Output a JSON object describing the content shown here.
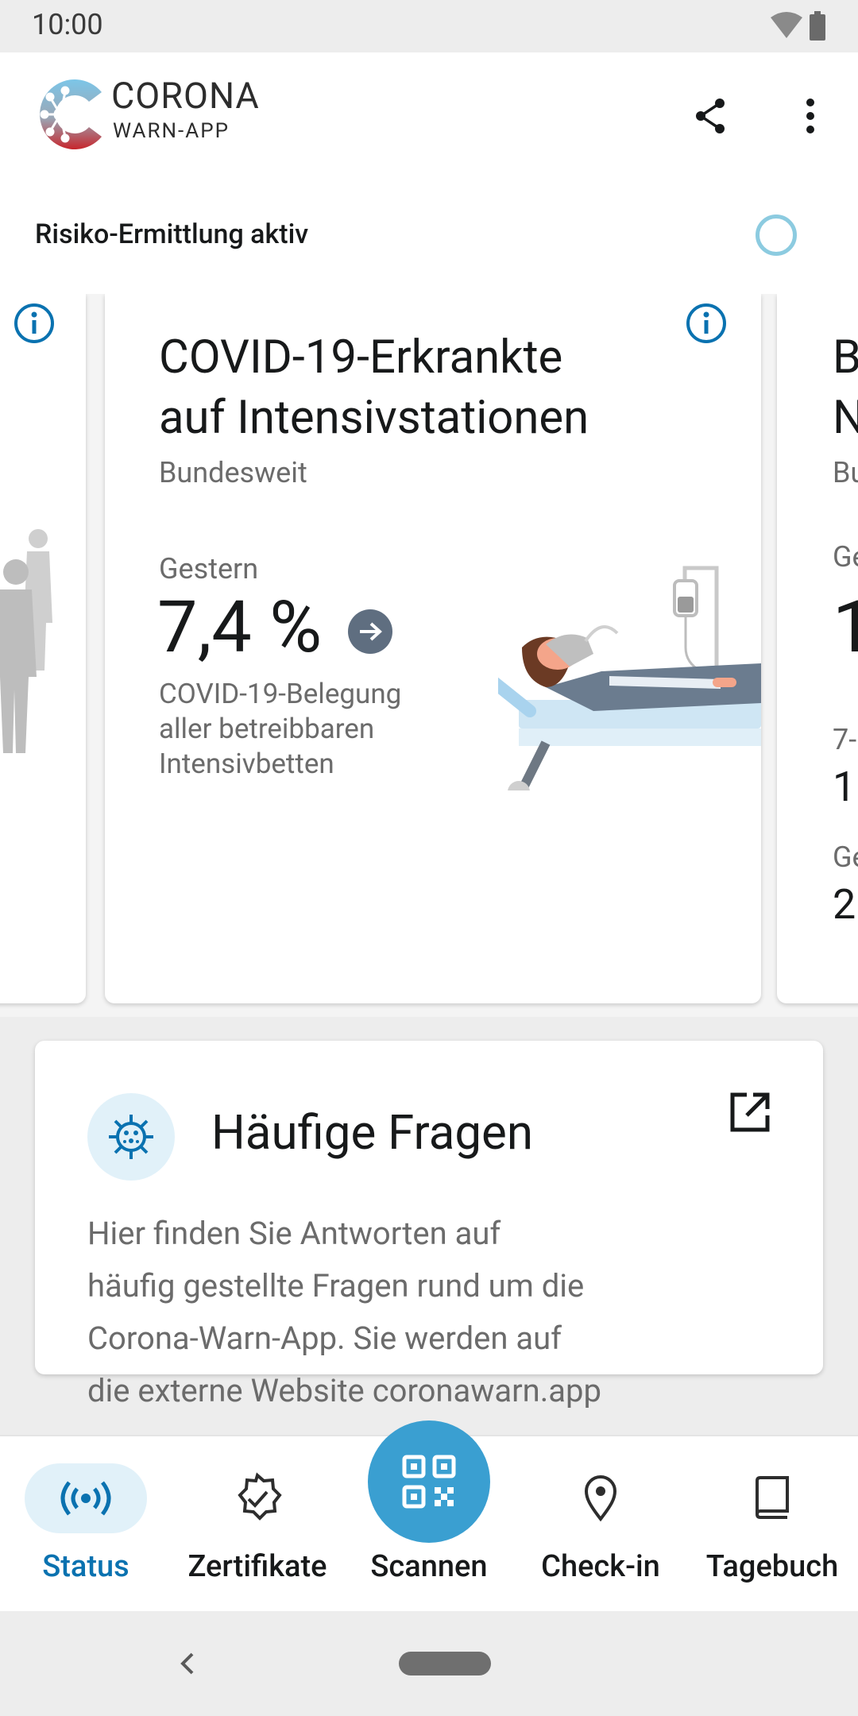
{
  "status_bar": {
    "time": "10:00"
  },
  "header": {
    "logo_title": "CORONA",
    "logo_subtitle": "WARN-APP",
    "risk_status": "Risiko-Ermittlung aktiv"
  },
  "stat_card": {
    "title_line1": "COVID-19-Erkrankte",
    "title_line2": "auf Intensivstationen",
    "region": "Bundesweit",
    "day_label": "Gestern",
    "value": "7,4 %",
    "desc_line1": "COVID-19-Belegung",
    "desc_line2": "aller betreibbaren",
    "desc_line3": "Intensivbetten"
  },
  "right_card_peek": {
    "title_line1": "B",
    "title_line2": "N",
    "region": "Bu",
    "day_label": "Ge",
    "value": "1",
    "row1_label": "7-",
    "row1_value": "1",
    "row2_label": "Ge",
    "row2_value": "2"
  },
  "faq_card": {
    "title": "Häufige Fragen",
    "text_line1": "Hier finden Sie Antworten auf",
    "text_line2": "häufig gestellte Fragen rund um die",
    "text_line3": "Corona-Warn-App. Sie werden auf",
    "text_line4": "die externe Website coronawarn.app"
  },
  "bottom_nav": {
    "items": [
      {
        "label": "Status",
        "icon": "broadcast-icon",
        "active": true
      },
      {
        "label": "Zertifikate",
        "icon": "certificate-badge-icon",
        "active": false
      },
      {
        "label": "Scannen",
        "icon": "qr-code-icon",
        "active": false
      },
      {
        "label": "Check-in",
        "icon": "location-pin-icon",
        "active": false
      },
      {
        "label": "Tagebuch",
        "icon": "book-icon",
        "active": false
      }
    ]
  },
  "colors": {
    "accent": "#0a72b0",
    "fab": "#3a9fd1",
    "active_pill": "#e1f1f9",
    "trend_icon": "#5f6e80"
  }
}
